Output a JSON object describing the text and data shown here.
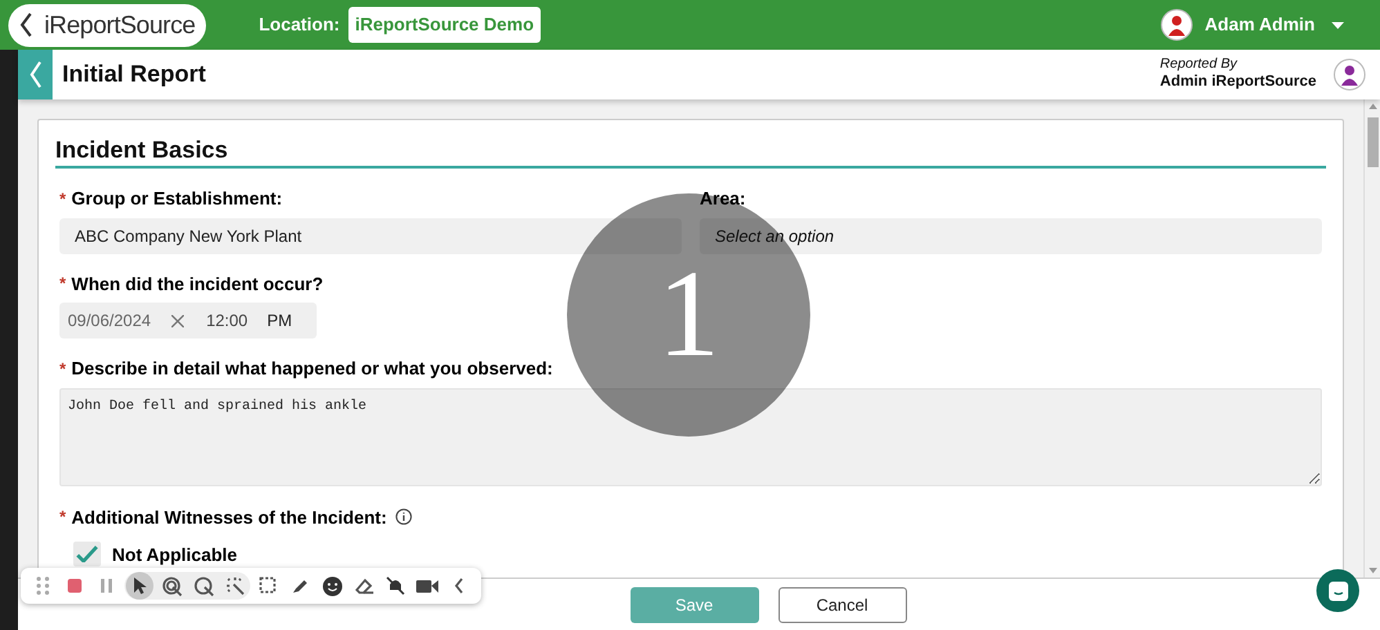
{
  "header": {
    "logo": "iReportSource",
    "location_label": "Location:",
    "location": "iReportSource Demo",
    "user": "Adam Admin"
  },
  "page": {
    "title": "Initial Report",
    "reported_by_label": "Reported By",
    "reported_by": "Admin iReportSource"
  },
  "section": {
    "title": "Incident Basics"
  },
  "group_field": {
    "required_mark": "*",
    "label": "Group or Establishment:",
    "value": "ABC Company New York Plant"
  },
  "area_field": {
    "label": "Area:",
    "placeholder": "Select an option"
  },
  "date_field": {
    "required_mark": "*",
    "label": "When did the incident occur?",
    "date": "09/06/2024",
    "time": "12:00",
    "period": "PM"
  },
  "description_field": {
    "required_mark": "*",
    "label": "Describe in detail what happened or what you observed:",
    "value": "John Doe fell and sprained his ankle"
  },
  "witnesses_field": {
    "required_mark": "*",
    "label": "Additional Witnesses of the Incident:",
    "option": {
      "label": "Not Applicable",
      "checked": true
    }
  },
  "footer": {
    "buttons": [
      {
        "label": "Save",
        "disabled": true
      },
      {
        "label": "Cancel",
        "disabled": false
      }
    ]
  },
  "step_marker": "1",
  "recorder_toolbar": {
    "tools": [
      {
        "kind": "drag",
        "selected": false
      },
      {
        "kind": "stop",
        "selected": false
      },
      {
        "kind": "pause",
        "selected": false
      },
      {
        "kind": "pointer",
        "selected": true
      },
      {
        "kind": "click",
        "selected": false
      },
      {
        "kind": "spotlight",
        "selected": false
      },
      {
        "kind": "sparkle",
        "selected": false
      },
      {
        "kind": "region",
        "selected": false
      },
      {
        "kind": "pen",
        "selected": false
      },
      {
        "kind": "emoji",
        "selected": false
      },
      {
        "kind": "eraser",
        "selected": false
      },
      {
        "kind": "mute",
        "selected": false
      },
      {
        "kind": "camera",
        "selected": false
      },
      {
        "kind": "collapse",
        "selected": false
      }
    ]
  }
}
